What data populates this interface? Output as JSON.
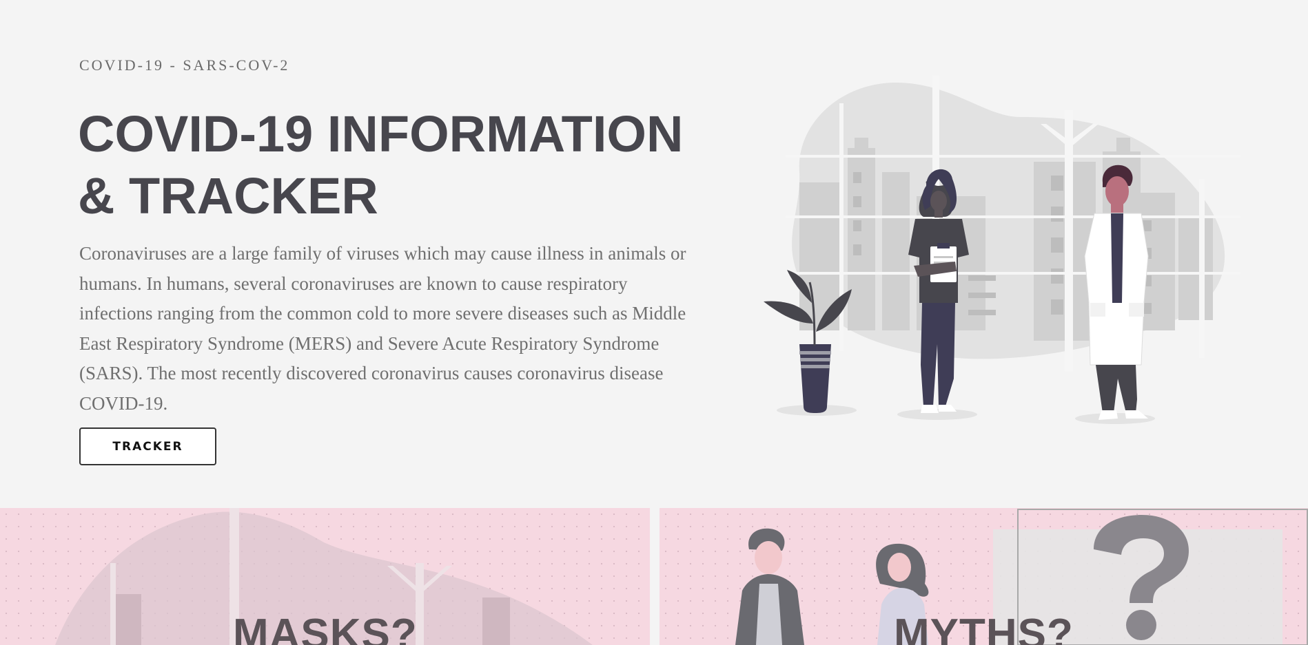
{
  "hero": {
    "eyebrow": "COVID-19 - SARS-COV-2",
    "title_line1": "COVID-19 INFORMATION",
    "title_line2": "& TRACKER",
    "intro": "Coronaviruses are a large family of viruses which may cause illness in animals or humans. In humans, several coronaviruses are known to cause respiratory infections ranging from the common cold to more severe diseases such as Middle East Respiratory Syndrome (MERS) and Severe Acute Respiratory Syndrome (SARS). The most recently discovered coronavirus causes coronavirus disease COVID-19.",
    "button_label": "TRACKER"
  },
  "cards": [
    {
      "title": "MASKS?"
    },
    {
      "title": "MYTHS?",
      "icon": "question-mark-icon"
    }
  ],
  "colors": {
    "background": "#f4f4f4",
    "headline": "#47464d",
    "body_text": "#6f6f6f",
    "card_background": "#f6d8e1"
  }
}
